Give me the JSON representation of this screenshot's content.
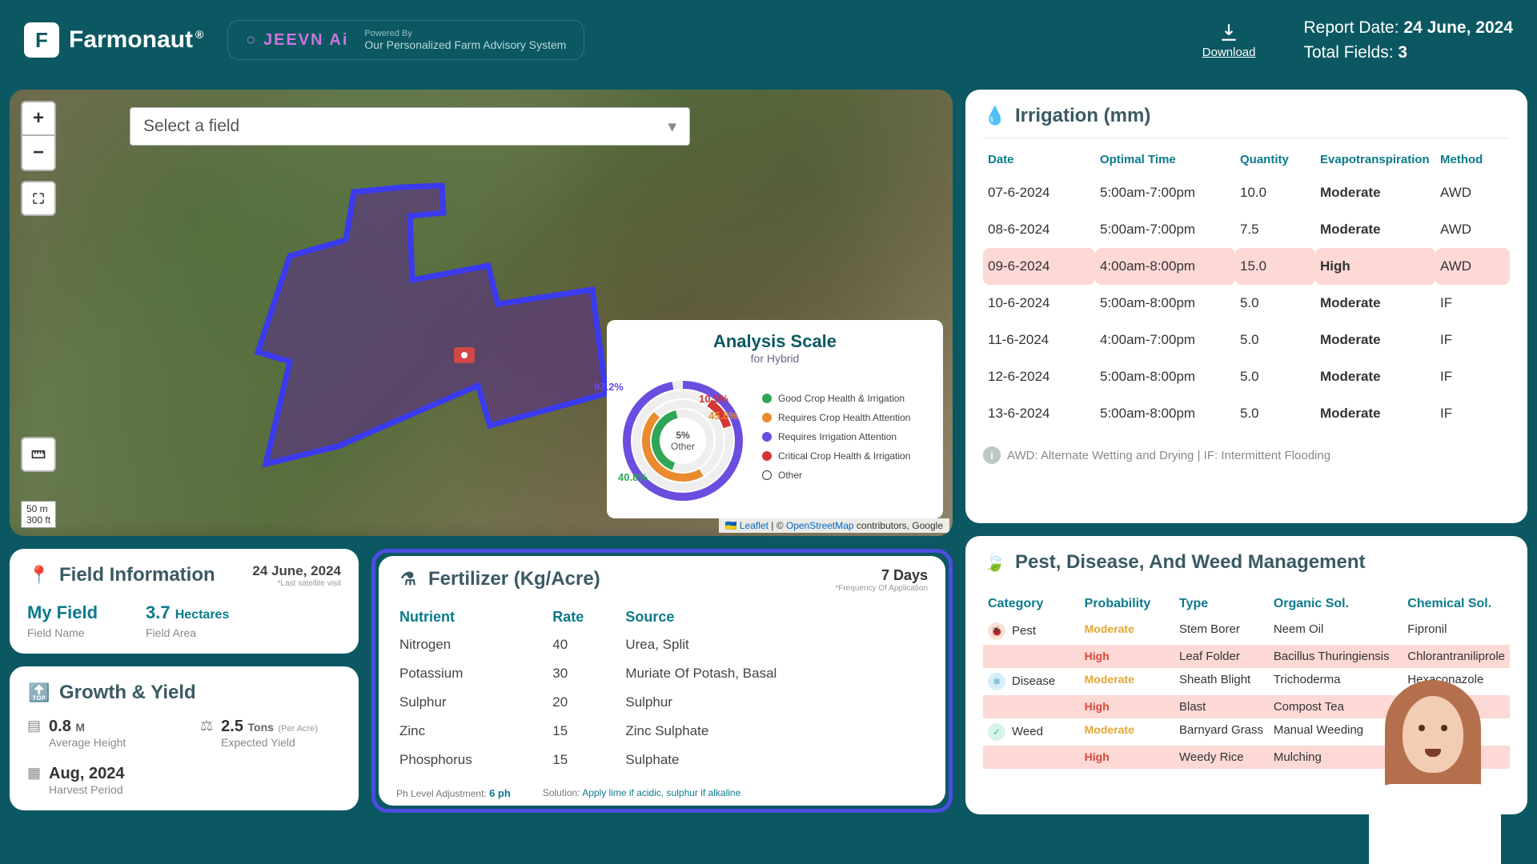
{
  "header": {
    "brand": "Farmonaut",
    "brand_mark": "F",
    "trademark": "®",
    "jeevn_logo": "○ JEEVN Ai",
    "jeevn_powered": "Powered By",
    "jeevn_tagline": "Our Personalized Farm Advisory System",
    "download_label": "Download",
    "report_date_label": "Report Date:",
    "report_date": "24 June, 2024",
    "total_fields_label": "Total Fields:",
    "total_fields": "3"
  },
  "map": {
    "field_select_placeholder": "Select a field",
    "scale": {
      "line1": "50 m",
      "line2": "300 ft"
    },
    "attrib_leaflet": "Leaflet",
    "attrib_osm": "OpenStreetMap",
    "attrib_rest": " contributors, Google",
    "analysis": {
      "title": "Analysis Scale",
      "subtitle": "for Hybrid",
      "center_val": "5%",
      "center_lbl": "Other",
      "pct_purple": "97.2%",
      "pct_red": "10.5%",
      "pct_orange": "45.8%",
      "pct_green": "40.8%",
      "legend": [
        {
          "color": "#2fa657",
          "label": "Good Crop Health & Irrigation"
        },
        {
          "color": "#e98b2e",
          "label": "Requires Crop Health Attention"
        },
        {
          "color": "#6b4de0",
          "label": "Requires Irrigation Attention"
        },
        {
          "color": "#d53535",
          "label": "Critical Crop Health & Irrigation"
        },
        {
          "color": "#ffffff",
          "label": "Other",
          "stroke": true
        }
      ]
    }
  },
  "field_info": {
    "title": "Field Information",
    "date": "24 June, 2024",
    "date_sub": "*Last satellite visit",
    "name_val": "My Field",
    "name_lbl": "Field Name",
    "area_val": "3.7",
    "area_unit": "Hectares",
    "area_lbl": "Field Area"
  },
  "growth": {
    "title": "Growth & Yield",
    "height_val": "0.8",
    "height_unit": "M",
    "height_lbl": "Average Height",
    "yield_val": "2.5",
    "yield_unit": "Tons",
    "yield_per": "(Per Acre)",
    "yield_lbl": "Expected Yield",
    "harvest_val": "Aug, 2024",
    "harvest_lbl": "Harvest Period"
  },
  "fertilizer": {
    "title": "Fertilizer (Kg/Acre)",
    "freq_val": "7 Days",
    "freq_lbl": "*Frequency Of Application",
    "headers": {
      "nutrient": "Nutrient",
      "rate": "Rate",
      "source": "Source"
    },
    "rows": [
      {
        "n": "Nitrogen",
        "r": "40",
        "s": "Urea, Split"
      },
      {
        "n": "Potassium",
        "r": "30",
        "s": "Muriate Of Potash, Basal"
      },
      {
        "n": "Sulphur",
        "r": "20",
        "s": "Sulphur"
      },
      {
        "n": "Zinc",
        "r": "15",
        "s": "Zinc Sulphate"
      },
      {
        "n": "Phosphorus",
        "r": "15",
        "s": "Sulphate"
      }
    ],
    "ph_label": "Ph Level Adjustment:",
    "ph_val": "6 ph",
    "sol_label": "Solution:",
    "sol_val": "Apply lime if acidic, sulphur if alkaline"
  },
  "irrigation": {
    "title": "Irrigation (mm)",
    "headers": {
      "date": "Date",
      "time": "Optimal Time",
      "qty": "Quantity",
      "evap": "Evapotranspiration",
      "method": "Method"
    },
    "rows": [
      {
        "date": "07-6-2024",
        "time": "5:00am-7:00pm",
        "qty": "10.0",
        "evap": "Moderate",
        "evap_cls": "mod",
        "method": "AWD"
      },
      {
        "date": "08-6-2024",
        "time": "5:00am-7:00pm",
        "qty": "7.5",
        "evap": "Moderate",
        "evap_cls": "mod",
        "method": "AWD"
      },
      {
        "date": "09-6-2024",
        "time": "4:00am-8:00pm",
        "qty": "15.0",
        "evap": "High",
        "evap_cls": "high",
        "method": "AWD",
        "row_cls": "high"
      },
      {
        "date": "10-6-2024",
        "time": "5:00am-8:00pm",
        "qty": "5.0",
        "evap": "Moderate",
        "evap_cls": "mod",
        "method": "IF"
      },
      {
        "date": "11-6-2024",
        "time": "4:00am-7:00pm",
        "qty": "5.0",
        "evap": "Moderate",
        "evap_cls": "mod",
        "method": "IF"
      },
      {
        "date": "12-6-2024",
        "time": "5:00am-8:00pm",
        "qty": "5.0",
        "evap": "Moderate",
        "evap_cls": "mod",
        "method": "IF"
      },
      {
        "date": "13-6-2024",
        "time": "5:00am-8:00pm",
        "qty": "5.0",
        "evap": "Moderate",
        "evap_cls": "mod",
        "method": "IF"
      }
    ],
    "footnote": "AWD: Alternate Wetting and Drying | IF: Intermittent Flooding"
  },
  "pest": {
    "title": "Pest, Disease, And Weed Management",
    "headers": {
      "cat": "Category",
      "prob": "Probability",
      "type": "Type",
      "org": "Organic Sol.",
      "chem": "Chemical Sol."
    },
    "groups": [
      {
        "cat": "Pest",
        "ico": "🐞",
        "ico_cls": "cat-pest",
        "rows": [
          {
            "prob": "Moderate",
            "pcls": "mod",
            "type": "Stem Borer",
            "org": "Neem Oil",
            "chem": "Fipronil"
          },
          {
            "prob": "High",
            "pcls": "high",
            "type": "Leaf Folder",
            "org": "Bacillus Thuringiensis",
            "chem": "Chlorantraniliprole",
            "hi": true
          }
        ]
      },
      {
        "cat": "Disease",
        "ico": "❄",
        "ico_cls": "cat-dis",
        "rows": [
          {
            "prob": "Moderate",
            "pcls": "mod",
            "type": "Sheath Blight",
            "org": "Trichoderma",
            "chem": "Hexaconazole"
          },
          {
            "prob": "High",
            "pcls": "high",
            "type": "Blast",
            "org": "Compost Tea",
            "chem": "",
            "hi": true
          }
        ]
      },
      {
        "cat": "Weed",
        "ico": "✓",
        "ico_cls": "cat-weed",
        "rows": [
          {
            "prob": "Moderate",
            "pcls": "mod",
            "type": "Barnyard Grass",
            "org": "Manual Weeding",
            "chem": ""
          },
          {
            "prob": "High",
            "pcls": "high",
            "type": "Weedy Rice",
            "org": "Mulching",
            "chem": "",
            "hi": true
          }
        ]
      }
    ]
  }
}
